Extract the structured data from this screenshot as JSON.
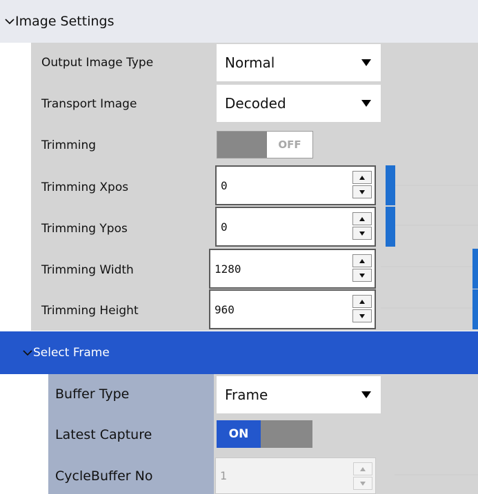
{
  "image_settings": {
    "header": "Image Settings",
    "output_image_type": {
      "label": "Output Image Type",
      "value": "Normal"
    },
    "transport_image": {
      "label": "Transport Image",
      "value": "Decoded"
    },
    "trimming": {
      "label": "Trimming",
      "state": "OFF"
    },
    "trimming_xpos": {
      "label": "Trimming Xpos",
      "value": "0",
      "slider_level": 0.0
    },
    "trimming_ypos": {
      "label": "Trimming Ypos",
      "value": "0",
      "slider_level": 0.0
    },
    "trimming_width": {
      "label": "Trimming Width",
      "value": "1280",
      "slider_level": 1.0
    },
    "trimming_height": {
      "label": "Trimming Height",
      "value": "960",
      "slider_level": 1.0
    }
  },
  "select_frame": {
    "header": "Select Frame",
    "buffer_type": {
      "label": "Buffer Type",
      "value": "Frame"
    },
    "latest_capture": {
      "label": "Latest Capture",
      "state": "ON"
    },
    "cyclebuffer_no": {
      "label": "CycleBuffer No",
      "value": "1"
    }
  },
  "colors": {
    "section_header_bg": "#e8eaf0",
    "selected_header_bg": "#2357cc",
    "row_bg": "#d4d4d4",
    "select_frame_label_bg": "#a4b0c8",
    "slider_thumb": "#1e6fd0",
    "on_toggle": "#2357cc"
  }
}
